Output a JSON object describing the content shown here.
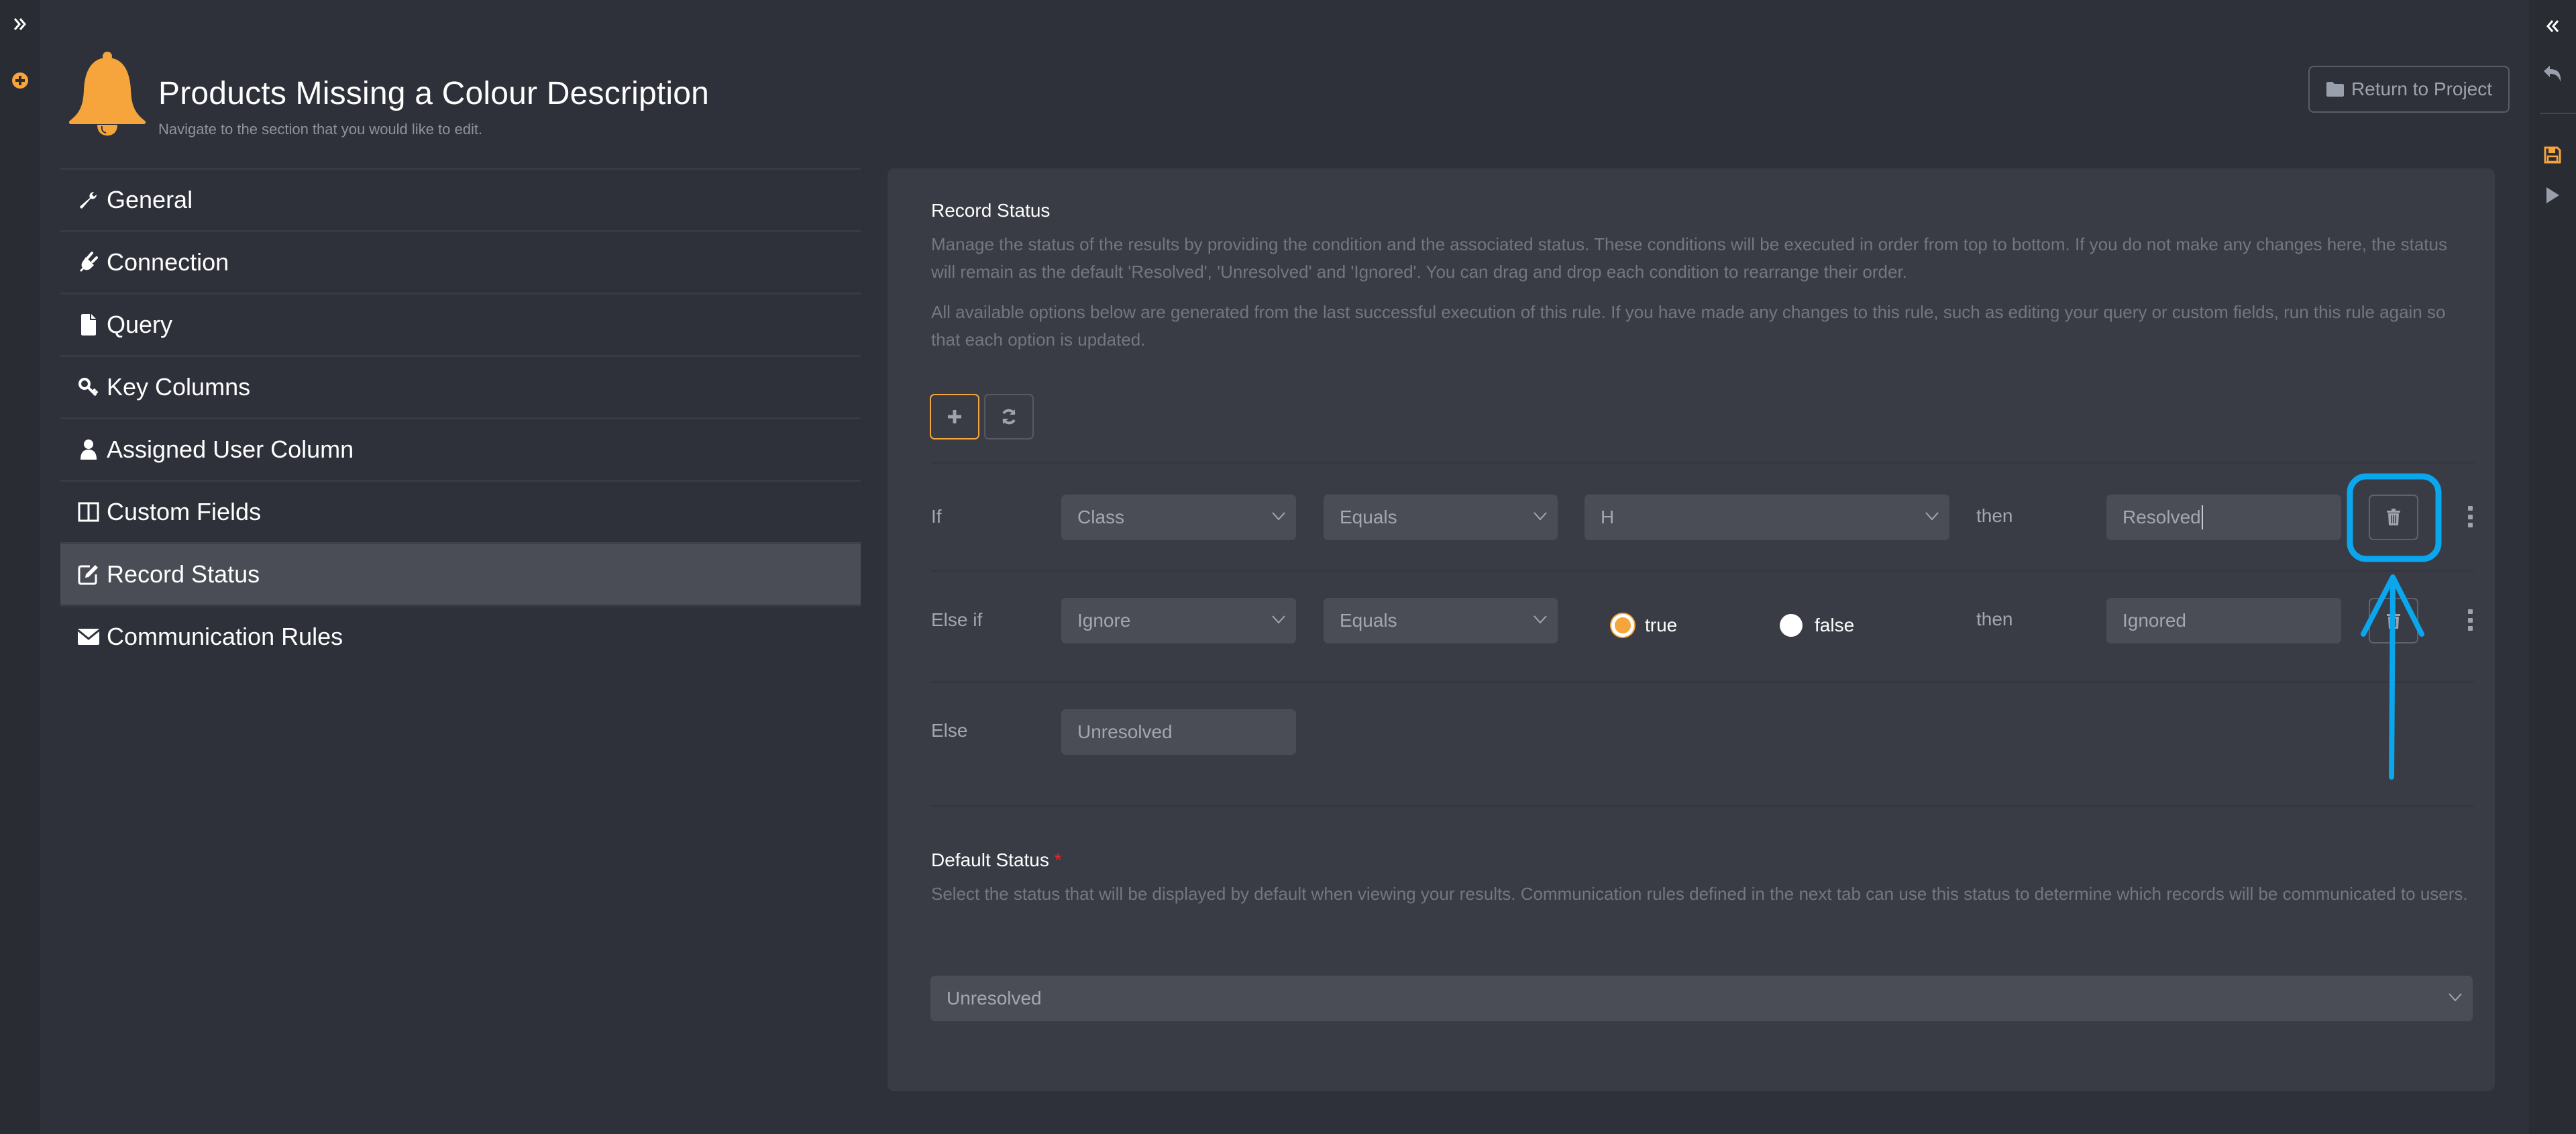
{
  "header": {
    "title": "Products Missing a Colour Description",
    "subtitle": "Navigate to the section that you would like to edit.",
    "return_button_label": "Return to Project",
    "icon": "bell-icon"
  },
  "left_rail": {
    "items": [
      {
        "name": "expand-panel",
        "icon": "double-chevron-right-icon"
      },
      {
        "name": "add",
        "icon": "plus-circle-icon"
      }
    ]
  },
  "right_rail": {
    "items": [
      {
        "name": "collapse-panel",
        "icon": "double-chevron-left-icon"
      },
      {
        "name": "undo",
        "icon": "undo-icon"
      },
      {
        "name": "save",
        "icon": "save-icon"
      },
      {
        "name": "run",
        "icon": "play-icon"
      }
    ]
  },
  "sidebar": {
    "items": [
      {
        "label": "General",
        "icon": "wrench-icon",
        "active": false
      },
      {
        "label": "Connection",
        "icon": "plug-icon",
        "active": false
      },
      {
        "label": "Query",
        "icon": "file-icon",
        "active": false
      },
      {
        "label": "Key Columns",
        "icon": "key-icon",
        "active": false
      },
      {
        "label": "Assigned User Column",
        "icon": "user-icon",
        "active": false
      },
      {
        "label": "Custom Fields",
        "icon": "columns-icon",
        "active": false
      },
      {
        "label": "Record Status",
        "icon": "edit-icon",
        "active": true
      },
      {
        "label": "Communication Rules",
        "icon": "envelope-icon",
        "active": false
      }
    ]
  },
  "record_status": {
    "title": "Record Status",
    "help1": "Manage the status of the results by providing the condition and the associated status. These conditions will be executed in order from top to bottom. If you do not make any changes here, the status will remain as the default 'Resolved', 'Unresolved' and 'Ignored'. You can drag and drop each condition to rearrange their order.",
    "help2": "All available options below are generated from the last successful execution of this rule. If you have made any changes to this rule, such as editing your query or custom fields, run this rule again so that each option is updated.",
    "add_button": "plus-icon",
    "refresh_button": "refresh-icon",
    "rows": [
      {
        "label": "If",
        "field": "Class",
        "operator": "Equals",
        "value": "H",
        "then_label": "then",
        "status": "Resolved"
      },
      {
        "label": "Else if",
        "field": "Ignore",
        "operator": "Equals",
        "options": [
          {
            "label": "true",
            "checked": true
          },
          {
            "label": "false",
            "checked": false
          }
        ],
        "then_label": "then",
        "status": "Ignored"
      }
    ],
    "else": {
      "label": "Else",
      "status": "Unresolved"
    }
  },
  "default_status": {
    "title": "Default Status",
    "required_mark": "*",
    "help": "Select the status that will be displayed by default when viewing your results. Communication rules defined in the next tab can use this status to determine which records will be communicated to users.",
    "value": "Unresolved"
  },
  "colors": {
    "accent": "#f6a53c",
    "annotation": "#0aa6ee",
    "background": "#2f313a",
    "panel": "#393b45",
    "field": "#4a4c56"
  }
}
